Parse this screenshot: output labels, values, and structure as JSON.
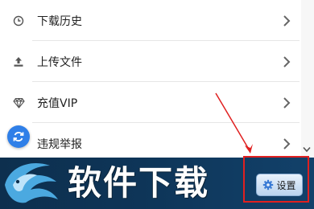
{
  "menu": {
    "items": [
      {
        "label": "下载历史",
        "icon": "clock-icon"
      },
      {
        "label": "上传文件",
        "icon": "upload-icon"
      },
      {
        "label": "充值VIP",
        "icon": "diamond-icon"
      },
      {
        "label": "违规举报",
        "icon": "report-icon"
      }
    ]
  },
  "banner": {
    "logo_text": "软件下载",
    "settings_label": "设置"
  },
  "colors": {
    "accent_blue": "#2f7fe8",
    "annotation_red": "#e02020",
    "banner_dark": "#0e3558"
  }
}
